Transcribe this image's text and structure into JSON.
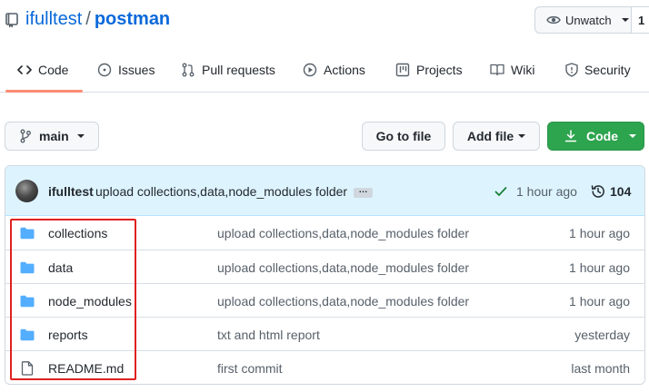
{
  "repo": {
    "owner": "ifulltest",
    "separator": "/",
    "name": "postman"
  },
  "watch": {
    "label": "Unwatch",
    "count": "1"
  },
  "tabs": [
    {
      "label": "Code",
      "icon": "code-icon"
    },
    {
      "label": "Issues",
      "icon": "issue-icon"
    },
    {
      "label": "Pull requests",
      "icon": "pull-request-icon"
    },
    {
      "label": "Actions",
      "icon": "play-icon"
    },
    {
      "label": "Projects",
      "icon": "project-icon"
    },
    {
      "label": "Wiki",
      "icon": "book-icon"
    },
    {
      "label": "Security",
      "icon": "shield-icon"
    }
  ],
  "toolbar": {
    "branch": "main",
    "goto_file": "Go to file",
    "add_file": "Add file",
    "code": "Code"
  },
  "commit": {
    "author": "ifulltest",
    "message": "upload collections,data,node_modules folder",
    "ellipsis": "…",
    "time": "1 hour ago",
    "count": "104"
  },
  "files": [
    {
      "name": "collections",
      "type": "folder",
      "message": "upload collections,data,node_modules folder",
      "time": "1 hour ago"
    },
    {
      "name": "data",
      "type": "folder",
      "message": "upload collections,data,node_modules folder",
      "time": "1 hour ago"
    },
    {
      "name": "node_modules",
      "type": "folder",
      "message": "upload collections,data,node_modules folder",
      "time": "1 hour ago"
    },
    {
      "name": "reports",
      "type": "folder",
      "message": "txt and html report",
      "time": "yesterday"
    },
    {
      "name": "README.md",
      "type": "file",
      "message": "first commit",
      "time": "last month"
    }
  ],
  "colors": {
    "link": "#0969da",
    "primary_button": "#2da44e",
    "commit_bar": "#ddf4ff",
    "tab_underline": "#fd8c73",
    "folder": "#54aeff",
    "highlight": "#e02020"
  }
}
